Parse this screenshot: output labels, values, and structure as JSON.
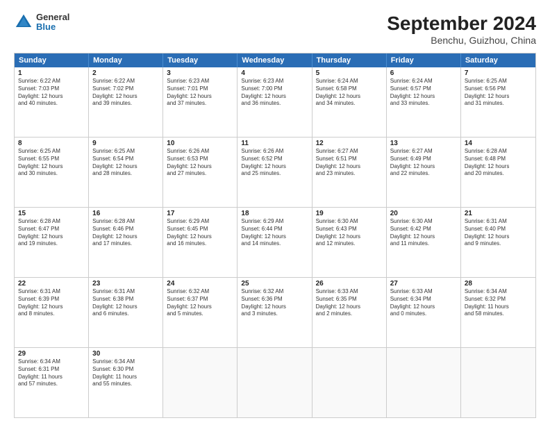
{
  "header": {
    "logo": {
      "general": "General",
      "blue": "Blue"
    },
    "title": "September 2024",
    "location": "Benchu, Guizhou, China"
  },
  "weekdays": [
    "Sunday",
    "Monday",
    "Tuesday",
    "Wednesday",
    "Thursday",
    "Friday",
    "Saturday"
  ],
  "rows": [
    [
      {
        "day": "1",
        "lines": [
          "Sunrise: 6:22 AM",
          "Sunset: 7:03 PM",
          "Daylight: 12 hours",
          "and 40 minutes."
        ]
      },
      {
        "day": "2",
        "lines": [
          "Sunrise: 6:22 AM",
          "Sunset: 7:02 PM",
          "Daylight: 12 hours",
          "and 39 minutes."
        ]
      },
      {
        "day": "3",
        "lines": [
          "Sunrise: 6:23 AM",
          "Sunset: 7:01 PM",
          "Daylight: 12 hours",
          "and 37 minutes."
        ]
      },
      {
        "day": "4",
        "lines": [
          "Sunrise: 6:23 AM",
          "Sunset: 7:00 PM",
          "Daylight: 12 hours",
          "and 36 minutes."
        ]
      },
      {
        "day": "5",
        "lines": [
          "Sunrise: 6:24 AM",
          "Sunset: 6:58 PM",
          "Daylight: 12 hours",
          "and 34 minutes."
        ]
      },
      {
        "day": "6",
        "lines": [
          "Sunrise: 6:24 AM",
          "Sunset: 6:57 PM",
          "Daylight: 12 hours",
          "and 33 minutes."
        ]
      },
      {
        "day": "7",
        "lines": [
          "Sunrise: 6:25 AM",
          "Sunset: 6:56 PM",
          "Daylight: 12 hours",
          "and 31 minutes."
        ]
      }
    ],
    [
      {
        "day": "8",
        "lines": [
          "Sunrise: 6:25 AM",
          "Sunset: 6:55 PM",
          "Daylight: 12 hours",
          "and 30 minutes."
        ]
      },
      {
        "day": "9",
        "lines": [
          "Sunrise: 6:25 AM",
          "Sunset: 6:54 PM",
          "Daylight: 12 hours",
          "and 28 minutes."
        ]
      },
      {
        "day": "10",
        "lines": [
          "Sunrise: 6:26 AM",
          "Sunset: 6:53 PM",
          "Daylight: 12 hours",
          "and 27 minutes."
        ]
      },
      {
        "day": "11",
        "lines": [
          "Sunrise: 6:26 AM",
          "Sunset: 6:52 PM",
          "Daylight: 12 hours",
          "and 25 minutes."
        ]
      },
      {
        "day": "12",
        "lines": [
          "Sunrise: 6:27 AM",
          "Sunset: 6:51 PM",
          "Daylight: 12 hours",
          "and 23 minutes."
        ]
      },
      {
        "day": "13",
        "lines": [
          "Sunrise: 6:27 AM",
          "Sunset: 6:49 PM",
          "Daylight: 12 hours",
          "and 22 minutes."
        ]
      },
      {
        "day": "14",
        "lines": [
          "Sunrise: 6:28 AM",
          "Sunset: 6:48 PM",
          "Daylight: 12 hours",
          "and 20 minutes."
        ]
      }
    ],
    [
      {
        "day": "15",
        "lines": [
          "Sunrise: 6:28 AM",
          "Sunset: 6:47 PM",
          "Daylight: 12 hours",
          "and 19 minutes."
        ]
      },
      {
        "day": "16",
        "lines": [
          "Sunrise: 6:28 AM",
          "Sunset: 6:46 PM",
          "Daylight: 12 hours",
          "and 17 minutes."
        ]
      },
      {
        "day": "17",
        "lines": [
          "Sunrise: 6:29 AM",
          "Sunset: 6:45 PM",
          "Daylight: 12 hours",
          "and 16 minutes."
        ]
      },
      {
        "day": "18",
        "lines": [
          "Sunrise: 6:29 AM",
          "Sunset: 6:44 PM",
          "Daylight: 12 hours",
          "and 14 minutes."
        ]
      },
      {
        "day": "19",
        "lines": [
          "Sunrise: 6:30 AM",
          "Sunset: 6:43 PM",
          "Daylight: 12 hours",
          "and 12 minutes."
        ]
      },
      {
        "day": "20",
        "lines": [
          "Sunrise: 6:30 AM",
          "Sunset: 6:42 PM",
          "Daylight: 12 hours",
          "and 11 minutes."
        ]
      },
      {
        "day": "21",
        "lines": [
          "Sunrise: 6:31 AM",
          "Sunset: 6:40 PM",
          "Daylight: 12 hours",
          "and 9 minutes."
        ]
      }
    ],
    [
      {
        "day": "22",
        "lines": [
          "Sunrise: 6:31 AM",
          "Sunset: 6:39 PM",
          "Daylight: 12 hours",
          "and 8 minutes."
        ]
      },
      {
        "day": "23",
        "lines": [
          "Sunrise: 6:31 AM",
          "Sunset: 6:38 PM",
          "Daylight: 12 hours",
          "and 6 minutes."
        ]
      },
      {
        "day": "24",
        "lines": [
          "Sunrise: 6:32 AM",
          "Sunset: 6:37 PM",
          "Daylight: 12 hours",
          "and 5 minutes."
        ]
      },
      {
        "day": "25",
        "lines": [
          "Sunrise: 6:32 AM",
          "Sunset: 6:36 PM",
          "Daylight: 12 hours",
          "and 3 minutes."
        ]
      },
      {
        "day": "26",
        "lines": [
          "Sunrise: 6:33 AM",
          "Sunset: 6:35 PM",
          "Daylight: 12 hours",
          "and 2 minutes."
        ]
      },
      {
        "day": "27",
        "lines": [
          "Sunrise: 6:33 AM",
          "Sunset: 6:34 PM",
          "Daylight: 12 hours",
          "and 0 minutes."
        ]
      },
      {
        "day": "28",
        "lines": [
          "Sunrise: 6:34 AM",
          "Sunset: 6:32 PM",
          "Daylight: 11 hours",
          "and 58 minutes."
        ]
      }
    ],
    [
      {
        "day": "29",
        "lines": [
          "Sunrise: 6:34 AM",
          "Sunset: 6:31 PM",
          "Daylight: 11 hours",
          "and 57 minutes."
        ]
      },
      {
        "day": "30",
        "lines": [
          "Sunrise: 6:34 AM",
          "Sunset: 6:30 PM",
          "Daylight: 11 hours",
          "and 55 minutes."
        ]
      },
      {
        "day": "",
        "lines": []
      },
      {
        "day": "",
        "lines": []
      },
      {
        "day": "",
        "lines": []
      },
      {
        "day": "",
        "lines": []
      },
      {
        "day": "",
        "lines": []
      }
    ]
  ]
}
